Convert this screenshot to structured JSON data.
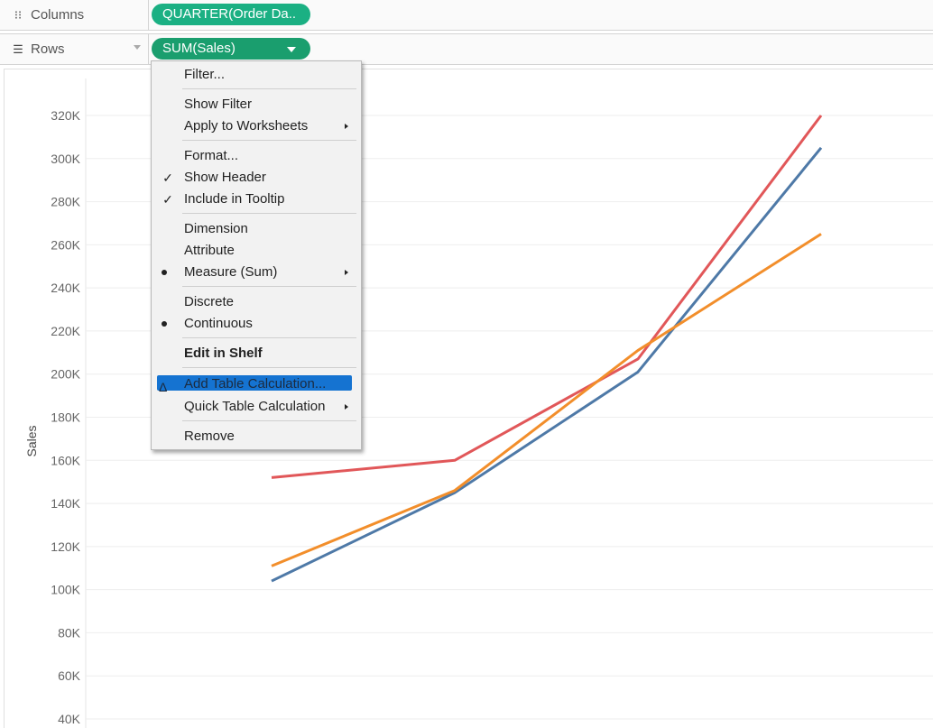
{
  "shelves": {
    "columns": {
      "label": "Columns",
      "icon": "columns-icon",
      "pill": "QUARTER(Order Da.."
    },
    "rows": {
      "label": "Rows",
      "icon": "rows-icon",
      "pill": "SUM(Sales)"
    }
  },
  "menu": {
    "filter": "Filter...",
    "show_filter": "Show Filter",
    "apply_to_worksheets": "Apply to Worksheets",
    "format": "Format...",
    "show_header": "Show Header",
    "include_in_tooltip": "Include in Tooltip",
    "dimension": "Dimension",
    "attribute": "Attribute",
    "measure": "Measure (Sum)",
    "discrete": "Discrete",
    "continuous": "Continuous",
    "edit_in_shelf": "Edit in Shelf",
    "add_table_calc": "Add Table Calculation...",
    "quick_table_calc": "Quick Table Calculation",
    "remove": "Remove"
  },
  "colors": {
    "pill_columns": "#1bb083",
    "pill_rows": "#1a9e6e",
    "menu_highlight": "#1573d1"
  },
  "chart_data": {
    "type": "line",
    "ylabel": "Sales",
    "ylim": [
      40000,
      330000
    ],
    "yticks": [
      "40K",
      "60K",
      "80K",
      "100K",
      "120K",
      "140K",
      "160K",
      "180K",
      "200K",
      "220K",
      "240K",
      "260K",
      "280K",
      "300K",
      "320K"
    ],
    "ytick_values": [
      40000,
      60000,
      80000,
      100000,
      120000,
      140000,
      160000,
      180000,
      200000,
      220000,
      240000,
      260000,
      280000,
      300000,
      320000
    ],
    "x": [
      1,
      2,
      3,
      4
    ],
    "grid": true,
    "series": [
      {
        "color": "#4e79a7",
        "values": [
          104000,
          145000,
          201000,
          305000
        ]
      },
      {
        "color": "#e15759",
        "values": [
          152000,
          160000,
          207000,
          320000
        ]
      },
      {
        "color": "#f28e2b",
        "values": [
          111000,
          146000,
          211000,
          265000
        ]
      }
    ]
  }
}
